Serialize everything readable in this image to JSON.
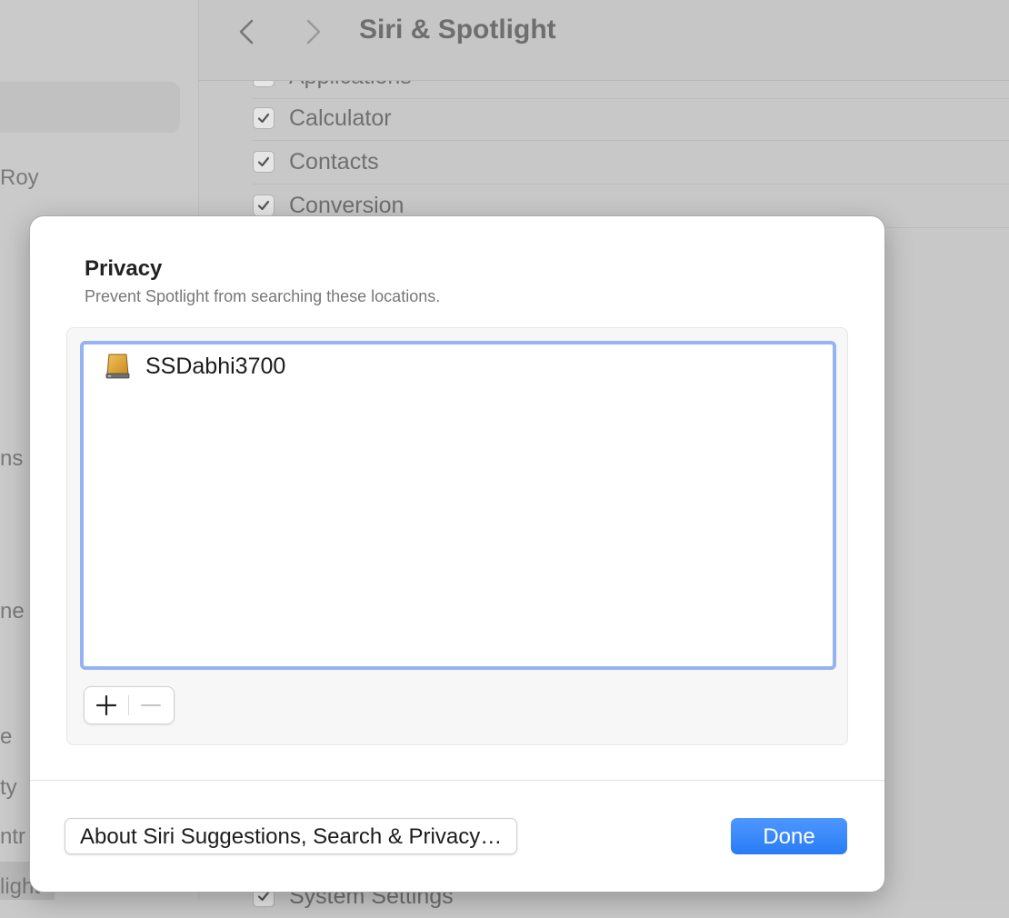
{
  "window": {
    "title": "Siri & Spotlight",
    "sidebar_fragments": [
      "Roy",
      "ns",
      "ne",
      "e",
      "ty",
      "ntr",
      "light"
    ]
  },
  "background_list": {
    "items": [
      {
        "label": "Applications",
        "checked": true
      },
      {
        "label": "Calculator",
        "checked": true
      },
      {
        "label": "Contacts",
        "checked": true
      },
      {
        "label": "Conversion",
        "checked": true
      },
      {
        "label": "System Settings",
        "checked": true
      }
    ]
  },
  "sheet": {
    "title": "Privacy",
    "subtitle": "Prevent Spotlight from searching these locations.",
    "locations": [
      {
        "name": "SSDabhi3700",
        "icon": "external-drive-icon"
      }
    ],
    "add_symbol": "+",
    "remove_symbol": "−",
    "about_button": "About Siri Suggestions, Search & Privacy…",
    "done_button": "Done"
  },
  "colors": {
    "accent": "#2a7cf5",
    "focus_ring": "#93b3f2",
    "drive_icon": "#d9a23a"
  }
}
